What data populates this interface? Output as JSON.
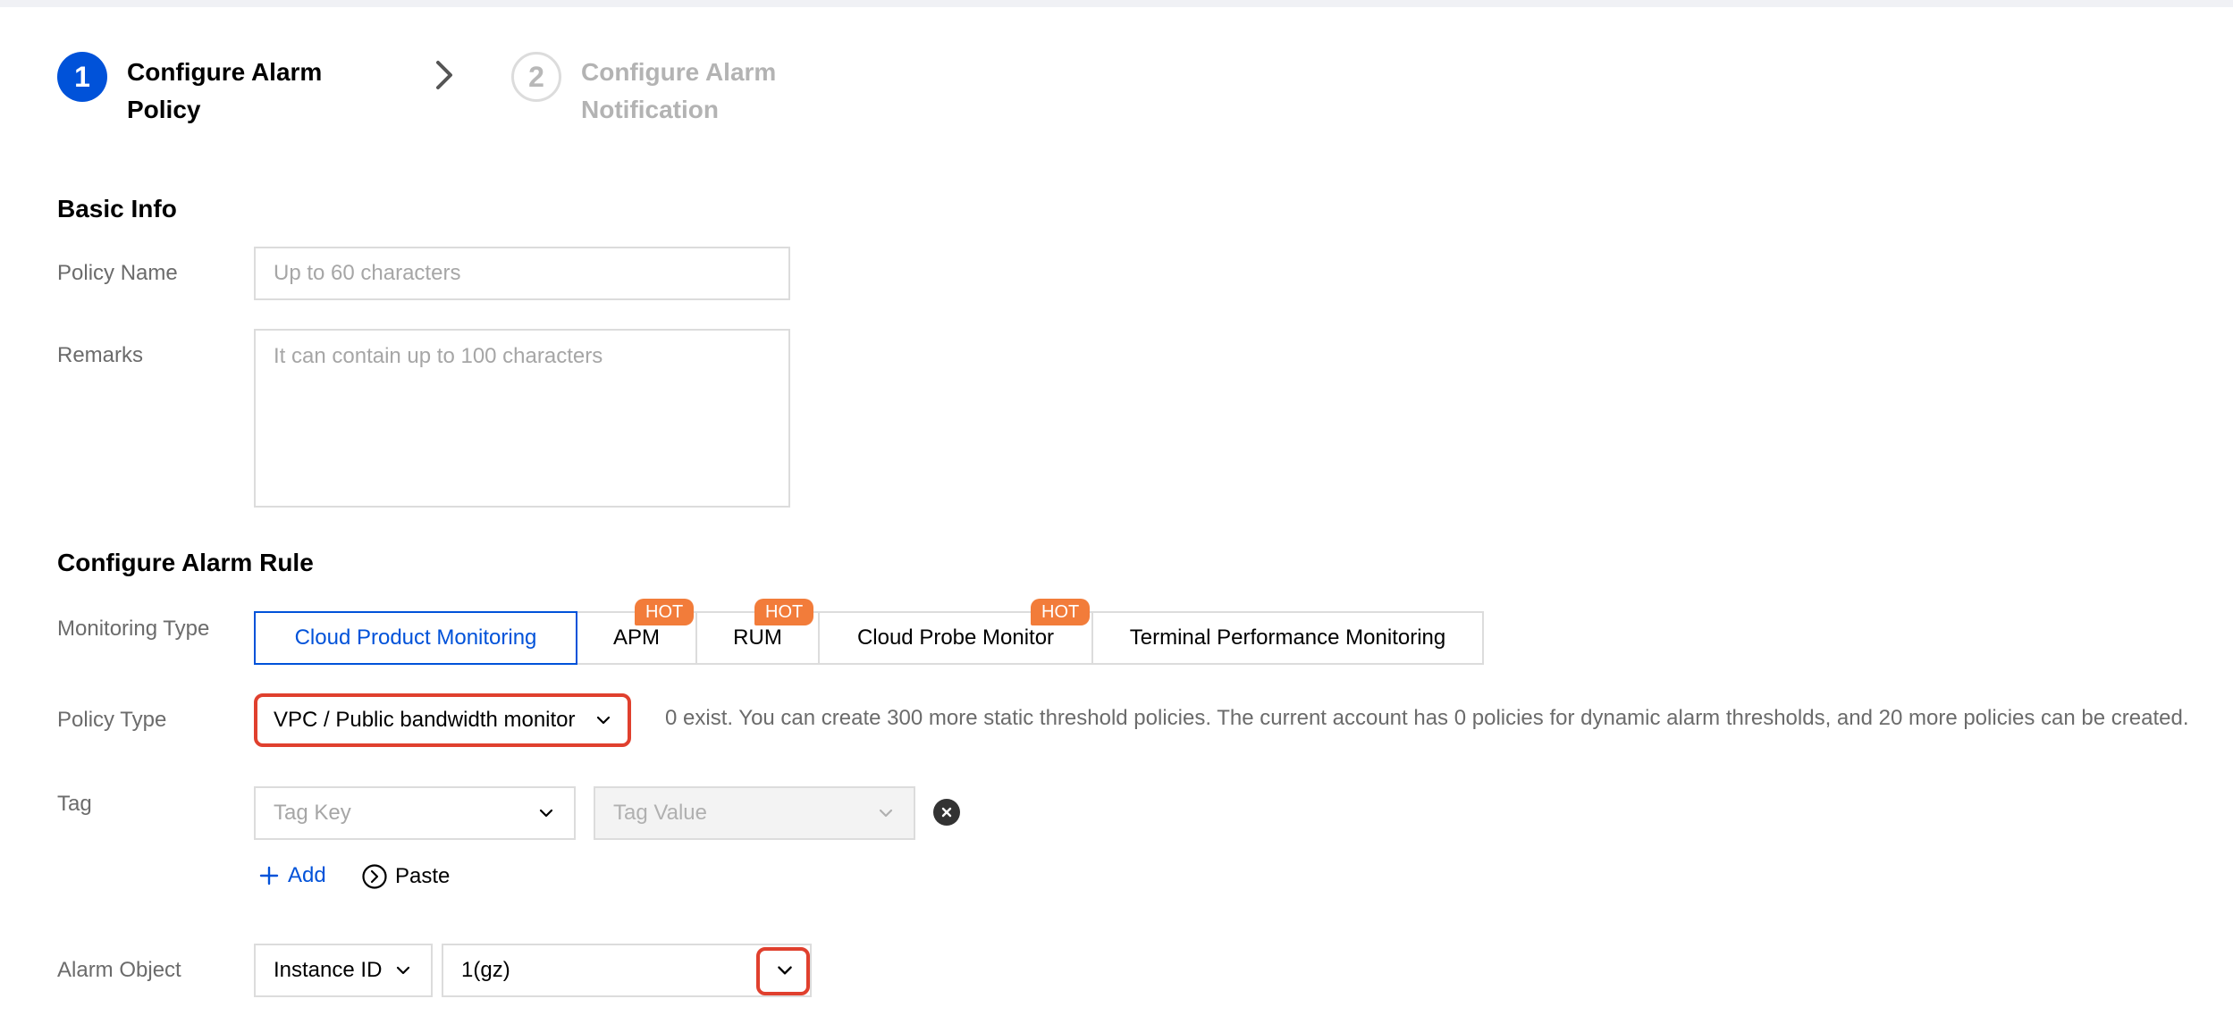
{
  "steps": [
    {
      "number": "1",
      "label": "Configure Alarm Policy",
      "state": "active"
    },
    {
      "number": "2",
      "label": "Configure Alarm Notification",
      "state": "inactive"
    }
  ],
  "basic_info": {
    "title": "Basic Info",
    "policy_name": {
      "label": "Policy Name",
      "placeholder": "Up to 60 characters",
      "value": ""
    },
    "remarks": {
      "label": "Remarks",
      "placeholder": "It can contain up to 100 characters",
      "value": ""
    }
  },
  "alarm_rule": {
    "title": "Configure Alarm Rule",
    "monitoring_type": {
      "label": "Monitoring Type",
      "tabs": [
        {
          "label": "Cloud Product Monitoring",
          "selected": true,
          "hot": false
        },
        {
          "label": "APM",
          "selected": false,
          "hot": true
        },
        {
          "label": "RUM",
          "selected": false,
          "hot": true
        },
        {
          "label": "Cloud Probe Monitor",
          "selected": false,
          "hot": true
        },
        {
          "label": "Terminal Performance Monitoring",
          "selected": false,
          "hot": false
        }
      ],
      "hot_label": "HOT"
    },
    "policy_type": {
      "label": "Policy Type",
      "value": "VPC / Public bandwidth monitor",
      "info": "0 exist. You can create 300 more static threshold policies. The current account has 0 policies for dynamic alarm thresholds, and 20 more policies can be created."
    },
    "tag": {
      "label": "Tag",
      "key_placeholder": "Tag Key",
      "value_placeholder": "Tag Value",
      "add_label": "Add",
      "paste_label": "Paste"
    },
    "alarm_object": {
      "label": "Alarm Object",
      "type_value": "Instance ID",
      "instance_value": "1(gz)"
    }
  },
  "colors": {
    "primary": "#0052d9",
    "hot_badge": "#f27c3a",
    "highlight": "#e0402e"
  }
}
